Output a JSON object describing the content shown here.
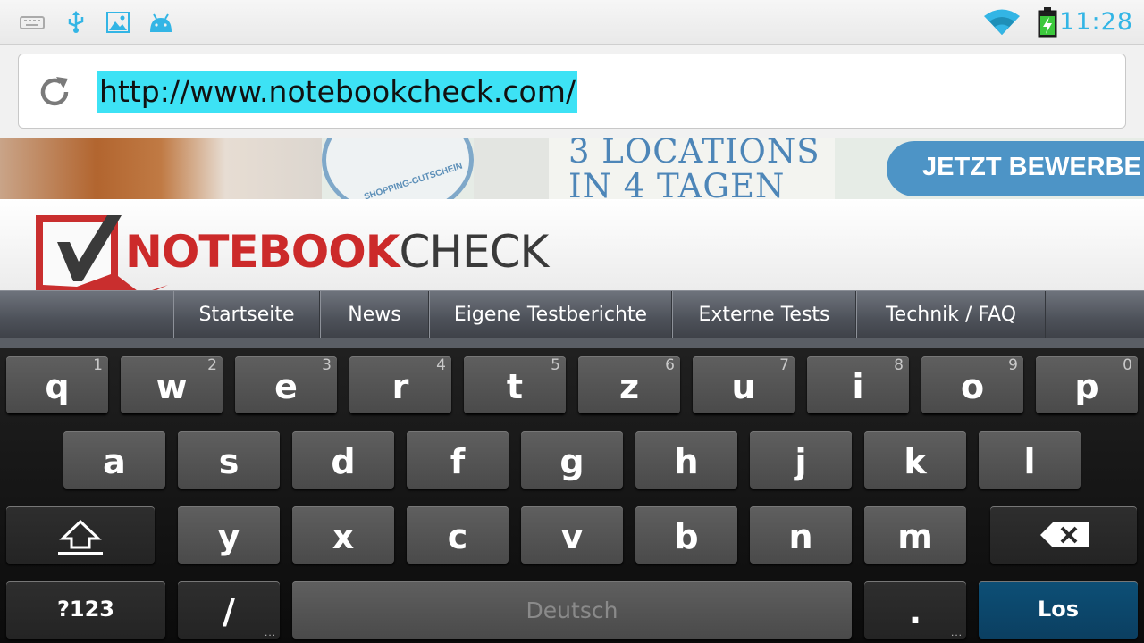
{
  "status_bar": {
    "left_icons": [
      "keyboard-icon",
      "usb-icon",
      "image-icon",
      "android-debug-icon"
    ],
    "right_icons": [
      "wifi-icon",
      "battery-charging-icon"
    ],
    "time": "11:28",
    "accent_color": "#33b5e5"
  },
  "browser": {
    "reload_icon": "reload-icon",
    "url": "http://www.notebookcheck.com/",
    "selection_color": "#3de2f5"
  },
  "banner_ad": {
    "seal_text": "SHOPPING-GUTSCHEIN",
    "headline_line1": "3 LOCATIONS",
    "headline_line2": "IN 4 TAGEN",
    "cta": "JETZT BEWERBE"
  },
  "site": {
    "logo_part1": "NOTEBOOK",
    "logo_part2": "CHECK",
    "brand_red": "#cc2a2a",
    "nav": [
      "Startseite",
      "News",
      "Eigene Testberichte",
      "Externe Tests",
      "Technik / FAQ"
    ]
  },
  "keyboard": {
    "row1": [
      {
        "key": "q",
        "hint": "1"
      },
      {
        "key": "w",
        "hint": "2"
      },
      {
        "key": "e",
        "hint": "3"
      },
      {
        "key": "r",
        "hint": "4"
      },
      {
        "key": "t",
        "hint": "5"
      },
      {
        "key": "z",
        "hint": "6"
      },
      {
        "key": "u",
        "hint": "7"
      },
      {
        "key": "i",
        "hint": "8"
      },
      {
        "key": "o",
        "hint": "9"
      },
      {
        "key": "p",
        "hint": "0"
      }
    ],
    "row2": [
      "a",
      "s",
      "d",
      "f",
      "g",
      "h",
      "j",
      "k",
      "l"
    ],
    "row3": [
      "y",
      "x",
      "c",
      "v",
      "b",
      "n",
      "m"
    ],
    "shift_icon": "shift-icon",
    "backspace_icon": "backspace-icon",
    "symbols": "?123",
    "slash": "/",
    "space": "Deutsch",
    "period": ".",
    "enter": "Los",
    "more_dots": "...",
    "enter_color": "#0b3f61"
  }
}
